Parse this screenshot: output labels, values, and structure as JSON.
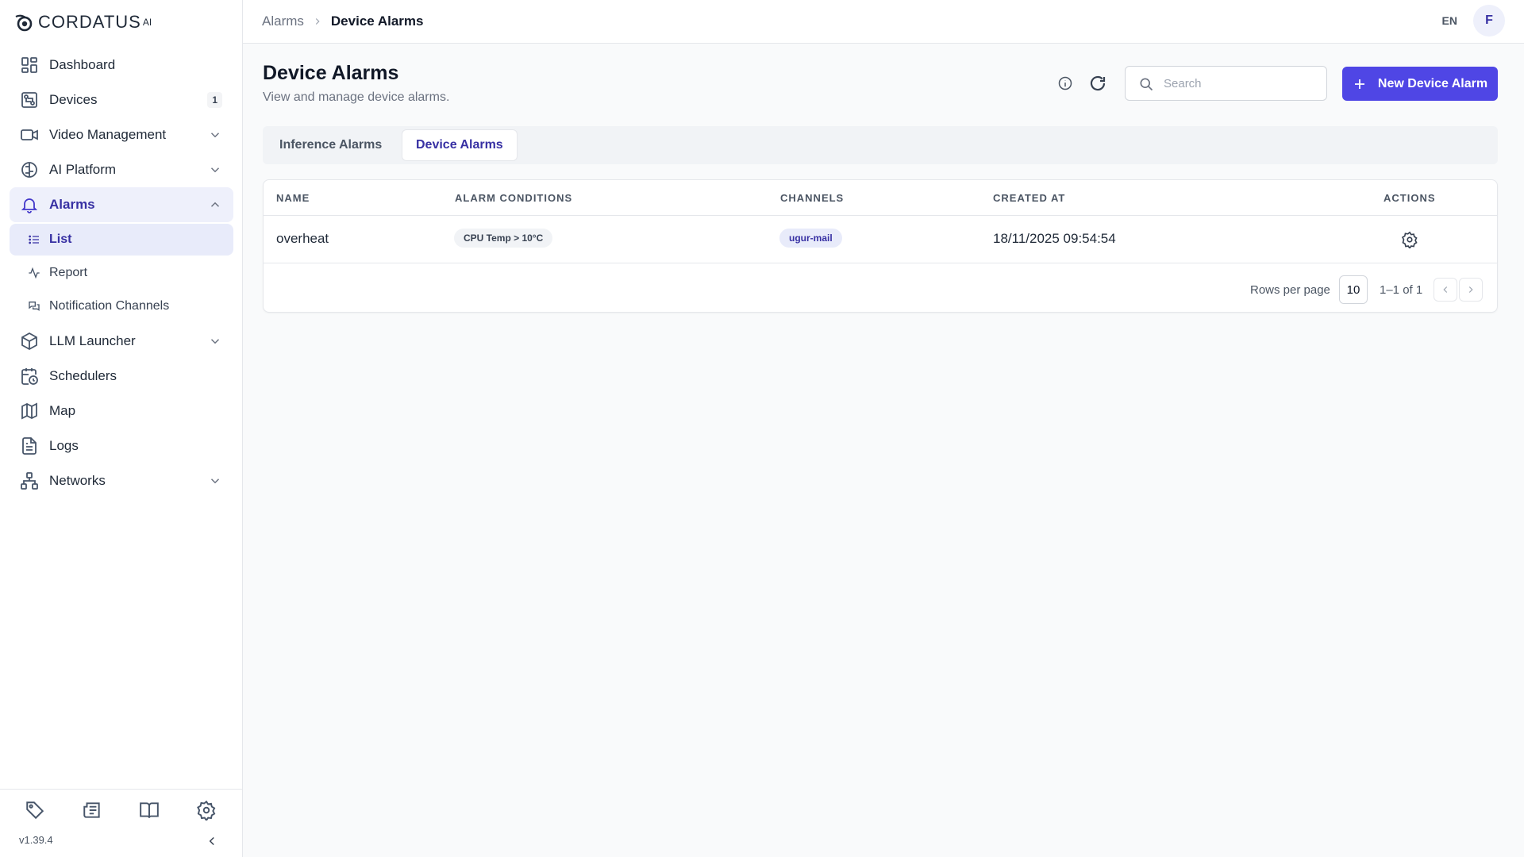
{
  "app": {
    "logo_text": "CORDATUS",
    "logo_suffix": "AI",
    "version": "v1.39.4"
  },
  "sidebar": {
    "items": [
      {
        "label": "Dashboard",
        "icon": "dashboard-icon"
      },
      {
        "label": "Devices",
        "icon": "devices-icon",
        "count": "1"
      },
      {
        "label": "Video Management",
        "icon": "video-icon"
      },
      {
        "label": "AI Platform",
        "icon": "brain-icon"
      },
      {
        "label": "Alarms",
        "icon": "bell-icon"
      },
      {
        "label": "LLM Launcher",
        "icon": "cube-icon"
      },
      {
        "label": "Schedulers",
        "icon": "calendar-clock-icon"
      },
      {
        "label": "Map",
        "icon": "map-icon"
      },
      {
        "label": "Logs",
        "icon": "file-text-icon"
      },
      {
        "label": "Networks",
        "icon": "network-icon"
      }
    ],
    "alarms_sub": [
      {
        "label": "List",
        "icon": "list-icon"
      },
      {
        "label": "Report",
        "icon": "activity-icon"
      },
      {
        "label": "Notification Channels",
        "icon": "messages-icon"
      }
    ],
    "footer_icons": [
      "tag-icon",
      "newspaper-icon",
      "book-open-icon",
      "gear-icon"
    ]
  },
  "topbar": {
    "breadcrumb_parent": "Alarms",
    "breadcrumb_current": "Device Alarms",
    "language": "EN",
    "avatar_initial": "F"
  },
  "page": {
    "title": "Device Alarms",
    "subtitle": "View and manage device alarms.",
    "search_placeholder": "Search",
    "new_button_label": "New Device Alarm"
  },
  "tabs": [
    {
      "label": "Inference Alarms",
      "active": false
    },
    {
      "label": "Device Alarms",
      "active": true
    }
  ],
  "table": {
    "columns": [
      "NAME",
      "ALARM CONDITIONS",
      "CHANNELS",
      "CREATED AT",
      "ACTIONS"
    ],
    "rows": [
      {
        "name": "overheat",
        "condition": "CPU Temp > 10°C",
        "channel": "ugur-mail",
        "created_at": "18/11/2025 09:54:54"
      }
    ]
  },
  "pagination": {
    "rows_per_page_label": "Rows per page",
    "rows_per_page": "10",
    "range": "1–1 of 1"
  },
  "colors": {
    "accent": "#4f46e5",
    "accent_text": "#3730a3",
    "active_bg": "#eef0fb"
  }
}
